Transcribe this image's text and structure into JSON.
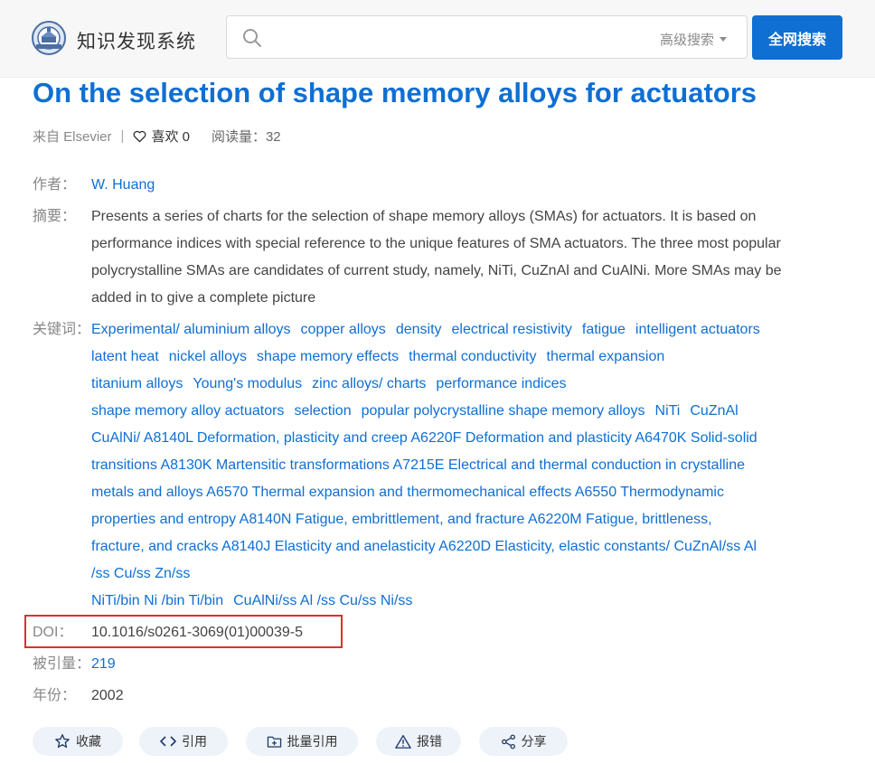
{
  "header": {
    "app_title": "知识发现系统",
    "search_placeholder": "",
    "advanced_search": "高级搜索",
    "search_button": "全网搜索"
  },
  "paper": {
    "title": "On the selection of shape memory alloys for actuators",
    "source": "来自 Elsevier",
    "likes_label": "喜欢 0",
    "reads": "阅读量：32",
    "author_label": "作者：",
    "author": "W. Huang",
    "abstract_label": "摘要：",
    "abstract_lines": [
      "Presents a series of charts for the selection of shape memory alloys (SMAs) for actuators. It is based on",
      "performance indices with special reference to the unique features of SMA actuators. The three most popular",
      "polycrystalline SMAs are candidates of current study, namely, NiTi, CuZnAl and CuAlNi. More SMAs may be",
      "added in to give a complete picture"
    ],
    "keywords_label": "关键词：",
    "keyword_lines": [
      [
        "Experimental/ aluminium alloys",
        "copper alloys",
        "density",
        "electrical resistivity",
        "fatigue",
        "intelligent actuators"
      ],
      [
        "latent heat",
        "nickel alloys",
        "shape memory effects",
        "thermal conductivity",
        "thermal expansion"
      ],
      [
        "titanium alloys",
        "Young's modulus",
        "zinc alloys/ charts",
        "performance indices"
      ],
      [
        "shape memory alloy actuators",
        "selection",
        "popular polycrystalline shape memory alloys",
        "NiTi",
        "CuZnAl"
      ],
      [
        "CuAlNi/ A8140L Deformation, plasticity and creep A6220F Deformation and plasticity A6470K Solid-solid"
      ],
      [
        "transitions A8130K Martensitic transformations A7215E Electrical and thermal conduction in crystalline"
      ],
      [
        "metals and alloys A6570 Thermal expansion and thermomechanical effects A6550 Thermodynamic"
      ],
      [
        "properties and entropy A8140N Fatigue, embrittlement, and fracture A6220M Fatigue, brittleness,"
      ],
      [
        "fracture, and cracks A8140J Elasticity and anelasticity A6220D Elasticity, elastic constants/ CuZnAl/ss Al"
      ],
      [
        "/ss Cu/ss Zn/ss"
      ],
      [
        "NiTi/bin Ni /bin Ti/bin",
        "CuAlNi/ss Al /ss Cu/ss Ni/ss"
      ]
    ],
    "doi_label": "DOI：",
    "doi": "10.1016/s0261-3069(01)00039-5",
    "cited_label": "被引量：",
    "cited": "219",
    "year_label": "年份：",
    "year": "2002"
  },
  "actions": {
    "favorite": "收藏",
    "cite": "引用",
    "batch_cite": "批量引用",
    "report_error": "报错",
    "share": "分享"
  },
  "colors": {
    "accent": "#0f6fd3",
    "highlight_border": "#e0302b"
  }
}
